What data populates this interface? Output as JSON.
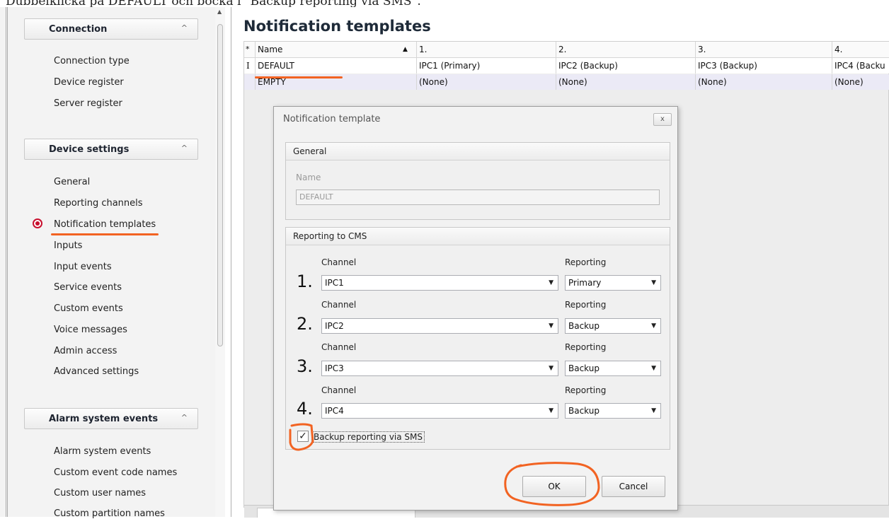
{
  "caption": "Dubbelklicka på DEFAULT och bocka i \"Backup reporting via SMS\".",
  "sidebar": {
    "groups": [
      {
        "title": "Connection",
        "items": [
          "Connection type",
          "Device register",
          "Server register"
        ]
      },
      {
        "title": "Device settings",
        "items": [
          "General",
          "Reporting channels",
          "Notification templates",
          "Inputs",
          "Input events",
          "Service events",
          "Custom events",
          "Voice messages",
          "Admin access",
          "Advanced settings"
        ]
      },
      {
        "title": "Alarm system events",
        "items": [
          "Alarm system events",
          "Custom event code names",
          "Custom user names",
          "Custom partition names"
        ]
      }
    ],
    "collapse_glyph": "^",
    "selected_item": "Notification templates"
  },
  "main": {
    "title": "Notification templates",
    "grid": {
      "columns": [
        "*",
        "Name",
        "1.",
        "2.",
        "3.",
        "4."
      ],
      "rows": [
        {
          "marker": "I",
          "name": "DEFAULT",
          "c1": "IPC1 (Primary)",
          "c2": "IPC2 (Backup)",
          "c3": "IPC3 (Backup)",
          "c4": "IPC4 (Backu"
        },
        {
          "marker": "",
          "name": "EMPTY",
          "c1": "(None)",
          "c2": "(None)",
          "c3": "(None)",
          "c4": "(None)"
        }
      ]
    }
  },
  "dialog": {
    "title": "Notification template",
    "close": "x",
    "general": {
      "header": "General",
      "name_label": "Name",
      "name_value": "DEFAULT"
    },
    "reporting": {
      "header": "Reporting to CMS",
      "channel_label": "Channel",
      "reporting_label": "Reporting",
      "rows": [
        {
          "num": "1.",
          "channel": "IPC1",
          "reporting": "Primary"
        },
        {
          "num": "2.",
          "channel": "IPC2",
          "reporting": "Backup"
        },
        {
          "num": "3.",
          "channel": "IPC3",
          "reporting": "Backup"
        },
        {
          "num": "4.",
          "channel": "IPC4",
          "reporting": "Backup"
        }
      ]
    },
    "sms_checkbox": {
      "label": "Backup reporting via SMS",
      "checked": true
    },
    "ok_label": "OK",
    "cancel_label": "Cancel"
  },
  "colors": {
    "annotation": "#f26322",
    "radio": "#c8102e"
  }
}
